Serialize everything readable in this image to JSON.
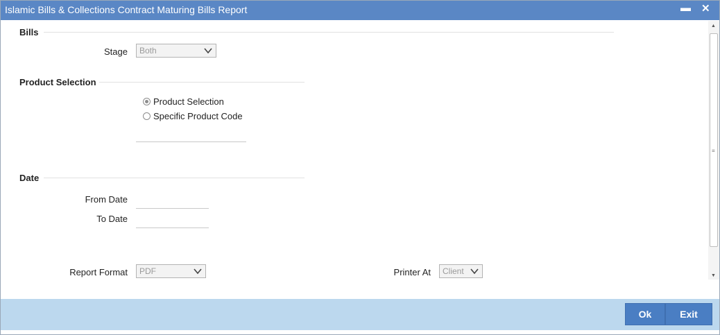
{
  "window": {
    "title": "Islamic Bills & Collections Contract Maturing Bills Report",
    "minimize_icon": "minimize-icon",
    "close_icon": "close-icon",
    "minimize_glyph": "▬",
    "close_glyph": "✕"
  },
  "bills": {
    "section_title": "Bills",
    "stage_label": "Stage",
    "stage_value": "Both"
  },
  "product_selection": {
    "section_title": "Product Selection",
    "options": [
      {
        "label": "Product Selection",
        "checked": true
      },
      {
        "label": "Specific Product Code",
        "checked": false
      }
    ],
    "product_code_value": ""
  },
  "date": {
    "section_title": "Date",
    "from_label": "From Date",
    "from_value": "",
    "to_label": "To Date",
    "to_value": ""
  },
  "report": {
    "format_label": "Report Format",
    "format_value": "PDF",
    "printer_label": "Printer At",
    "printer_value": "Client"
  },
  "footer": {
    "ok_label": "Ok",
    "exit_label": "Exit"
  },
  "colors": {
    "titlebar": "#5a87c5",
    "footer": "#bcd8ee",
    "button": "#4a7ec3"
  }
}
